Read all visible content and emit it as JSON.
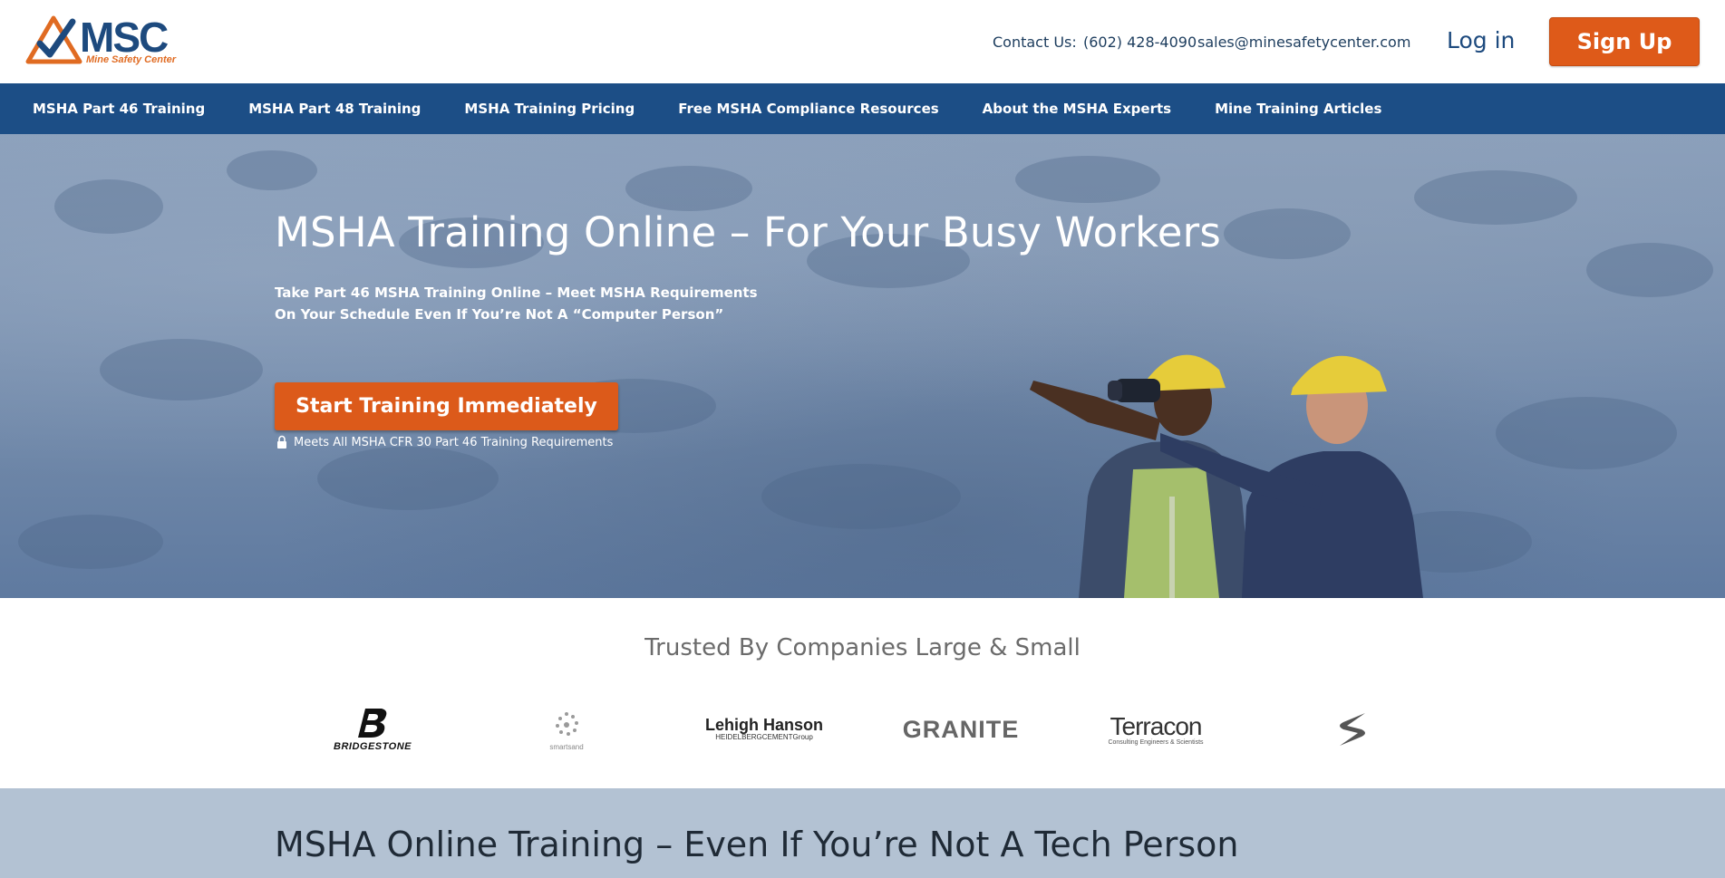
{
  "brand": {
    "name": "MSC",
    "tagline": "Mine Safety Center",
    "color_primary": "#1c4e86",
    "color_accent": "#de5a19"
  },
  "header": {
    "contact_label": "Contact Us:",
    "phone": "(602) 428-4090",
    "email": "sales@minesafetycenter.com",
    "login_label": "Log in",
    "signup_label": "Sign Up"
  },
  "nav": {
    "items": [
      "MSHA Part 46 Training",
      "MSHA Part 48 Training",
      "MSHA Training Pricing",
      "Free MSHA Compliance Resources",
      "About the MSHA Experts",
      "Mine Training Articles"
    ]
  },
  "hero": {
    "title": "MSHA Training Online – For Your Busy Workers",
    "subtitle": "Take Part 46 MSHA Training Online – Meet MSHA Requirements On Your Schedule Even If You’re Not A “Computer Person”",
    "cta_label": "Start Training Immediately",
    "requirement_note": "Meets All MSHA CFR 30 Part 46 Training Requirements",
    "lock_icon": "lock-icon"
  },
  "trusted": {
    "title": "Trusted By Companies Large & Small",
    "logos": {
      "bridgestone": "BRIDGESTONE",
      "smartsand": "smartsand",
      "lehigh_main": "Lehigh Hanson",
      "lehigh_sub": "HEIDELBERGCEMENTGroup",
      "granite": "GRANITE",
      "terracon_main": "Terracon",
      "terracon_sub": "Consulting Engineers & Scientists"
    }
  },
  "section2": {
    "title": "MSHA Online Training – Even If You’re Not A Tech Person"
  }
}
